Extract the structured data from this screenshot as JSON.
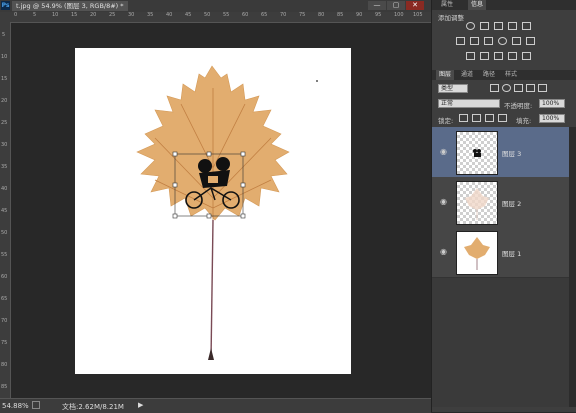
{
  "app": {
    "logo": "Ps",
    "document_tab": "t.jpg @ 54.9% (图层 3, RGB/8#) *",
    "window_buttons": [
      "—",
      "▢",
      "✕"
    ]
  },
  "ruler": {
    "top_ticks": [
      "0",
      "5",
      "10",
      "15",
      "20",
      "25",
      "30",
      "35",
      "40",
      "45",
      "50",
      "55",
      "60",
      "65",
      "70",
      "75",
      "80",
      "85",
      "90",
      "95",
      "100",
      "105"
    ],
    "left_ticks": [
      "5",
      "10",
      "15",
      "20",
      "25",
      "30",
      "35",
      "40",
      "45",
      "50",
      "55",
      "60",
      "65",
      "70",
      "75",
      "80",
      "85"
    ]
  },
  "status": {
    "zoom": "54.88%",
    "doc_info": "文档:2.62M/8.21M",
    "arrow": "▶"
  },
  "panel": {
    "top_tabs": [
      "",
      "属性",
      "信息"
    ],
    "adjust_title": "添加调整",
    "layer_tabs": [
      "图层",
      "通道",
      "路径",
      "样式"
    ],
    "kind_label": "类型",
    "blend_mode": "正常",
    "opacity_label": "不透明度:",
    "opacity_value": "100%",
    "lock_label": "锁定:",
    "fill_label": "填充:",
    "fill_value": "100%",
    "layers": [
      {
        "name": "图层 3",
        "selected": true
      },
      {
        "name": "图层 2",
        "selected": false
      },
      {
        "name": "图层 1",
        "selected": false
      }
    ]
  },
  "colors": {
    "leaf": "#e2ad6f",
    "leaf_vein": "#c88a4a",
    "selected_layer": "#5a6b8a"
  }
}
